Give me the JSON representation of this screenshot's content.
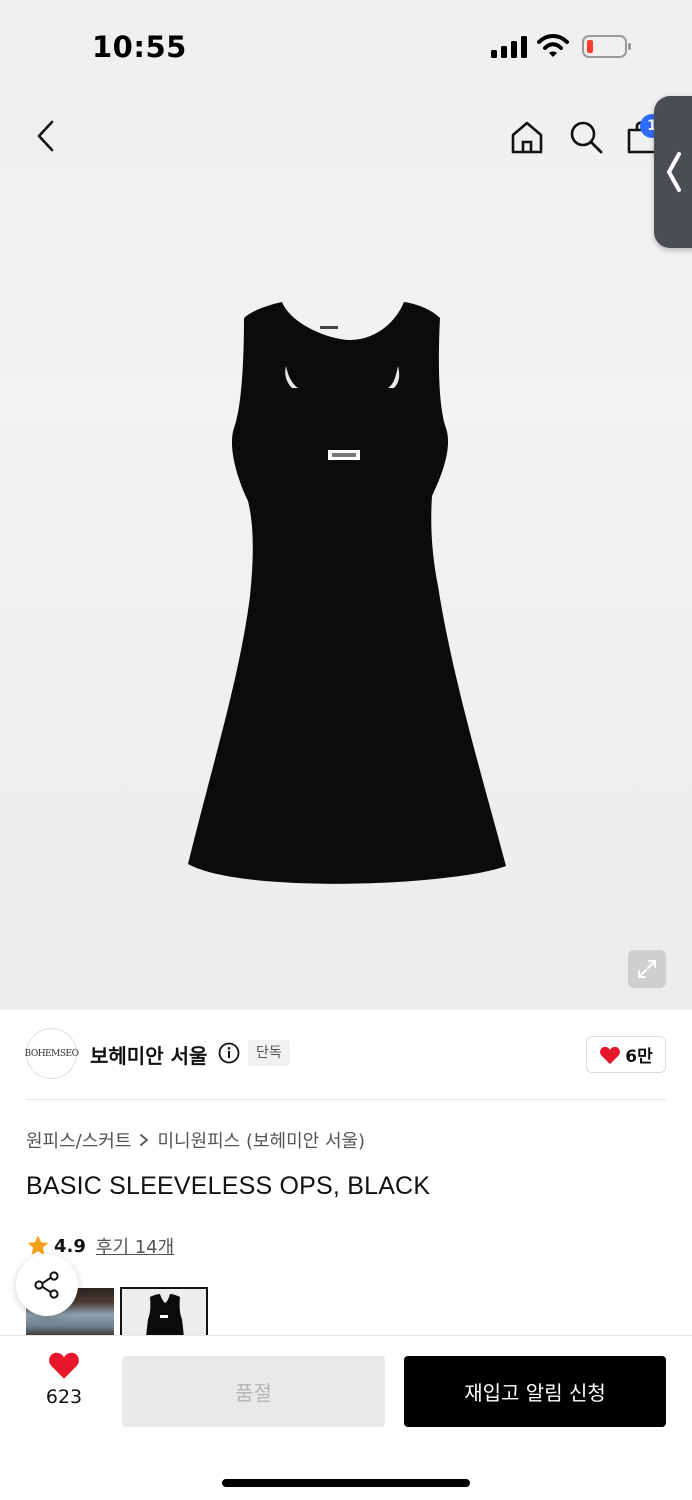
{
  "status": {
    "time": "10:55"
  },
  "nav": {
    "cart_count": "1"
  },
  "brand": {
    "logo_text": "BOHEMSEO",
    "name": "보헤미안 서울",
    "exclusive_label": "단독",
    "like_count": "6만"
  },
  "product": {
    "breadcrumb": [
      "원피스/스커트",
      "미니원피스 (보헤미안 서울)"
    ],
    "title": "BASIC SLEEVELESS OPS, BLACK",
    "rating": "4.9",
    "review_label": "후기 14개"
  },
  "bottom": {
    "wish_count": "623",
    "soldout_label": "품절",
    "restock_label": "재입고 알림 신청"
  },
  "colors": {
    "accent_blue": "#2f6bff",
    "heart_red": "#e8162a",
    "star_orange": "#f5a11b"
  }
}
